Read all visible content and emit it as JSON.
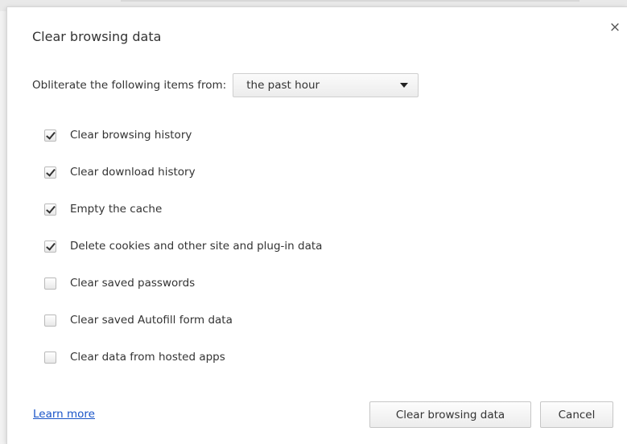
{
  "dialog": {
    "title": "Clear browsing data",
    "close_icon": "×"
  },
  "time_range": {
    "label": "Obliterate the following items from:",
    "selected": "the past hour"
  },
  "options": [
    {
      "label": "Clear browsing history",
      "checked": true
    },
    {
      "label": "Clear download history",
      "checked": true
    },
    {
      "label": "Empty the cache",
      "checked": true
    },
    {
      "label": "Delete cookies and other site and plug-in data",
      "checked": true
    },
    {
      "label": "Clear saved passwords",
      "checked": false
    },
    {
      "label": "Clear saved Autofill form data",
      "checked": false
    },
    {
      "label": "Clear data from hosted apps",
      "checked": false
    }
  ],
  "footer": {
    "learn_more": "Learn more",
    "clear_button": "Clear browsing data",
    "cancel_button": "Cancel"
  },
  "colors": {
    "link": "#1a55c8",
    "text": "#333333"
  }
}
